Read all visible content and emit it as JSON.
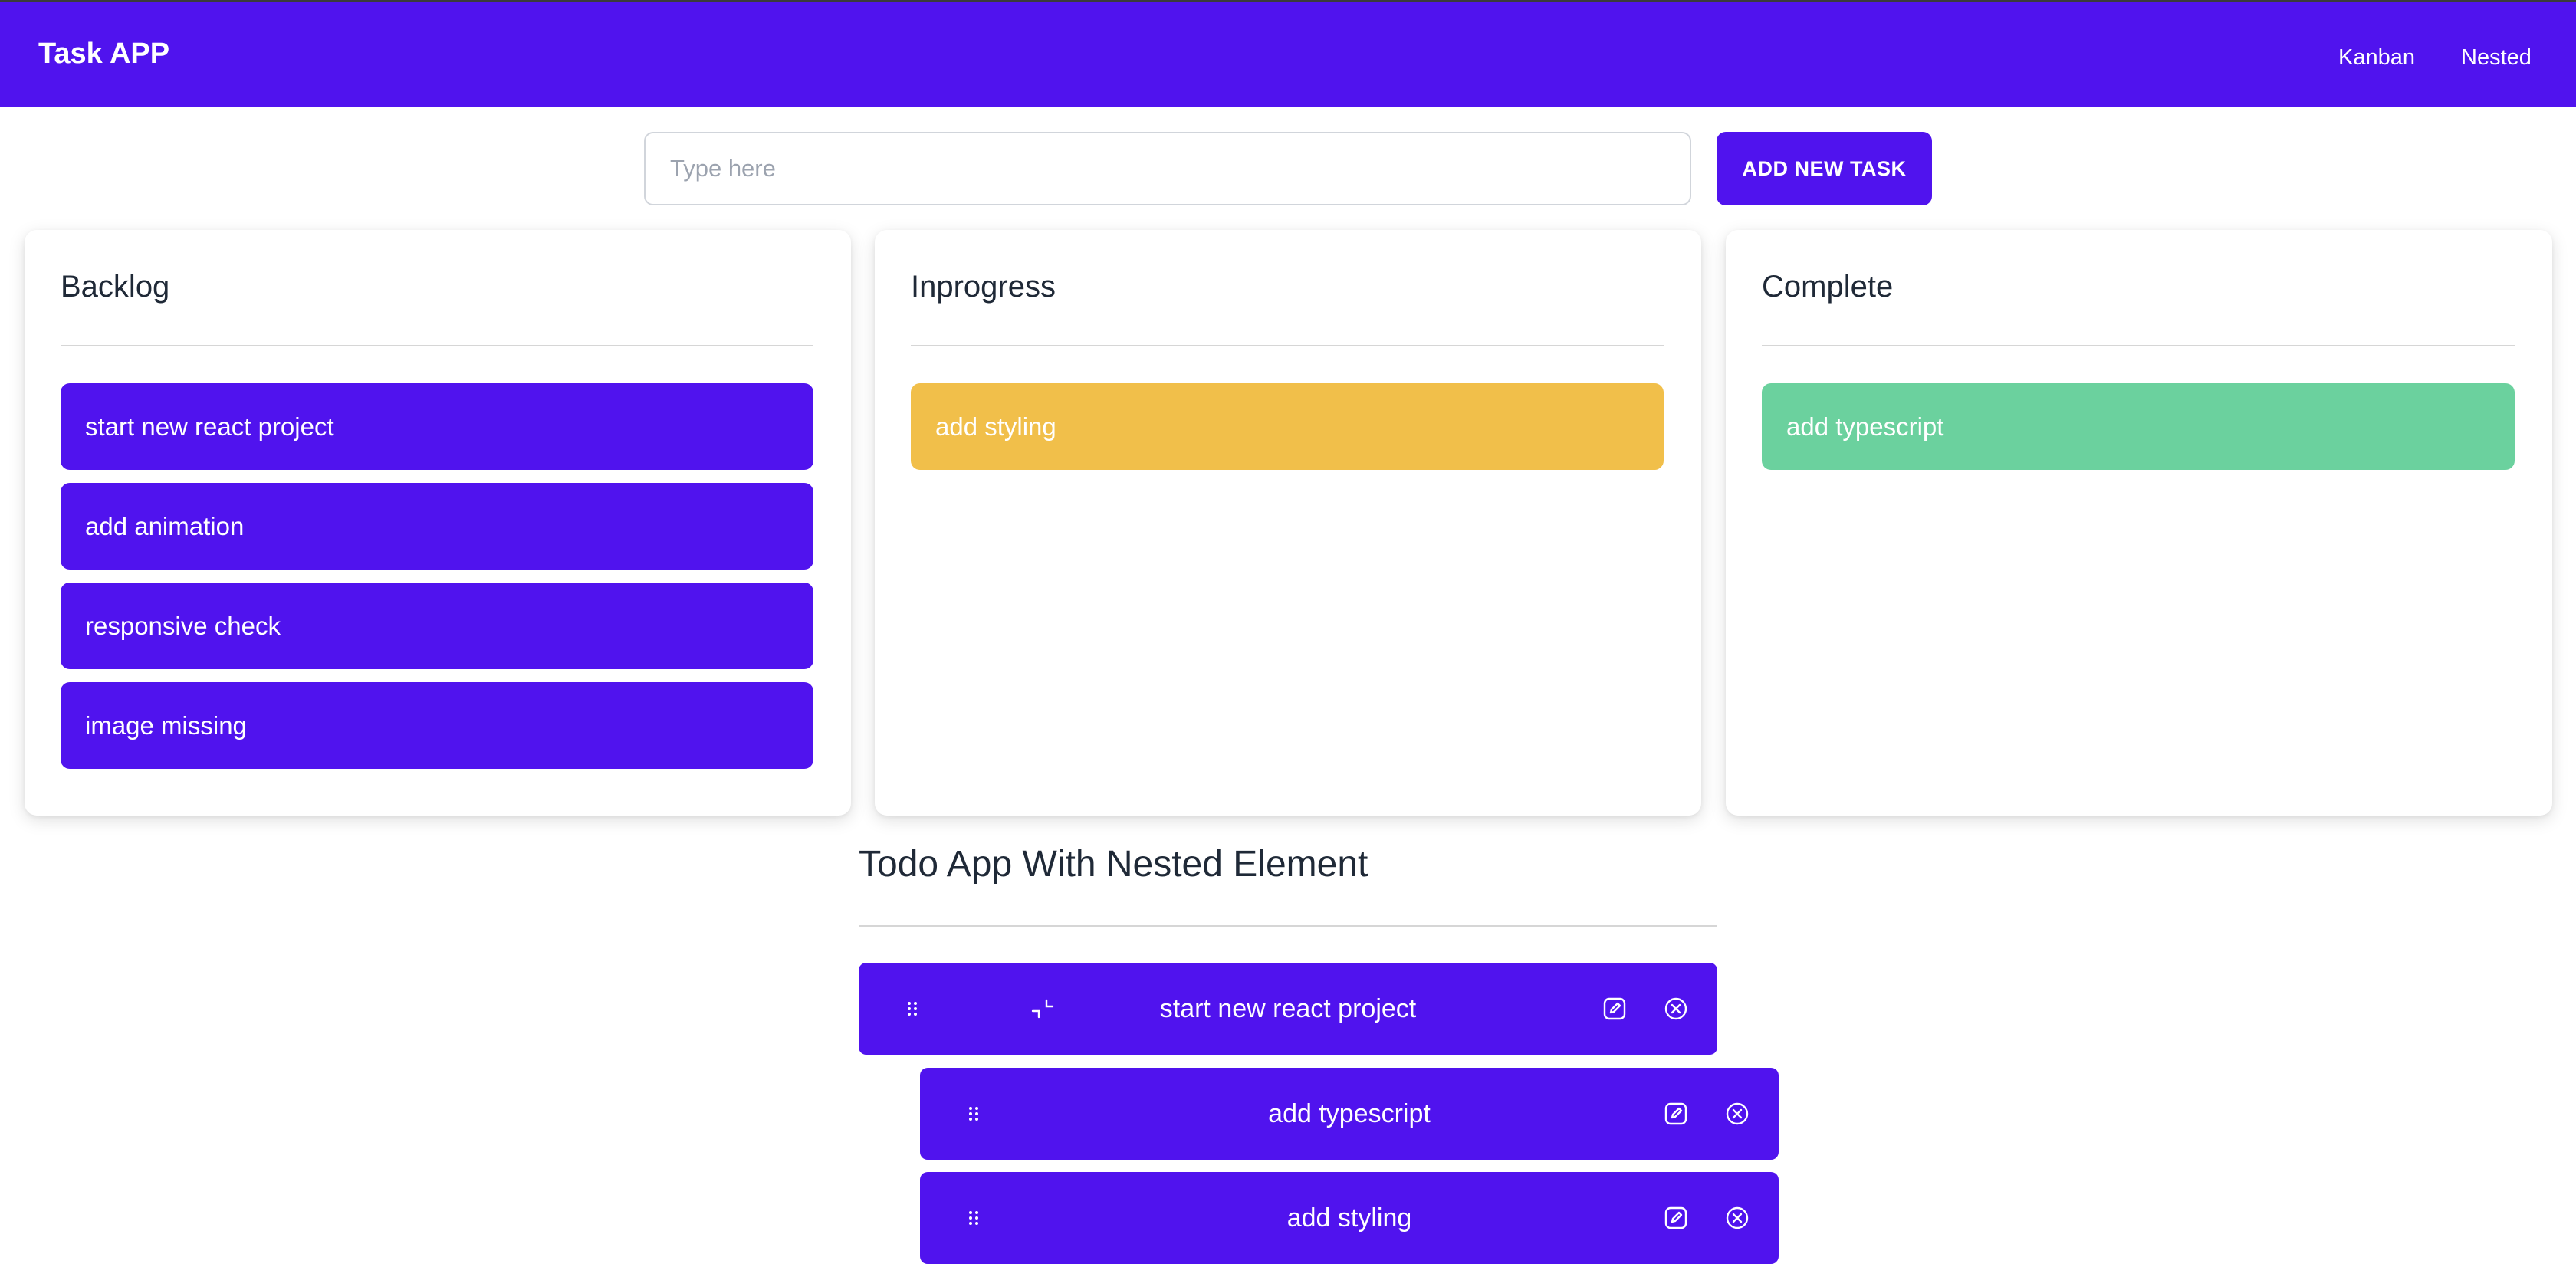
{
  "header": {
    "brand": "Task APP",
    "nav": [
      "Kanban",
      "Nested"
    ]
  },
  "add_task": {
    "placeholder": "Type here",
    "value": "",
    "button_label": "ADD NEW TASK"
  },
  "kanban": {
    "columns": [
      {
        "title": "Backlog",
        "cards": [
          "start new react project",
          "add animation",
          "responsive check",
          "image missing"
        ]
      },
      {
        "title": "Inprogress",
        "cards": [
          "add styling"
        ]
      },
      {
        "title": "Complete",
        "cards": [
          "add typescript"
        ]
      }
    ]
  },
  "nested": {
    "title": "Todo App With Nested Element",
    "items": [
      {
        "label": "start new react project",
        "depth": 0,
        "expanded": true
      },
      {
        "label": "add typescript",
        "depth": 1
      },
      {
        "label": "add styling",
        "depth": 1
      }
    ]
  },
  "colors": {
    "primary": "#5013ee",
    "inprogress": "#f1bf4a",
    "complete": "#6bd19e"
  },
  "icons": {
    "drag": "drag-handle-icon",
    "collapse": "collapse-icon",
    "edit": "edit-icon",
    "delete": "delete-icon"
  }
}
